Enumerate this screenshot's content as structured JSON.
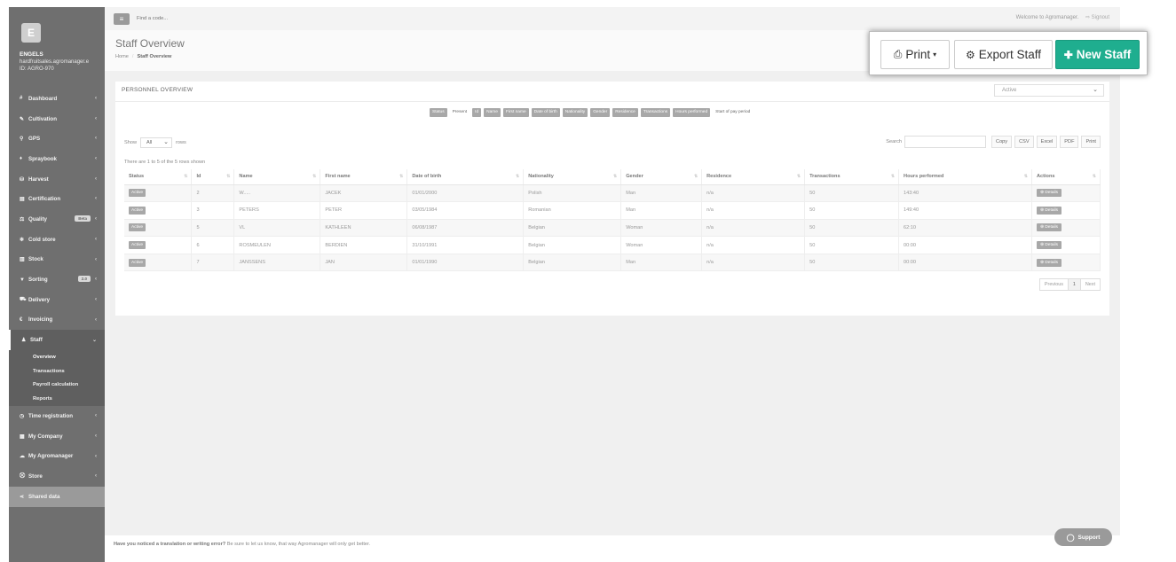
{
  "topbar": {
    "find_placeholder": "Find a code...",
    "welcome": "Welcome to Agromanager.",
    "signout": "Signout"
  },
  "sidebar": {
    "logo_letter": "E",
    "user_name": "ENGELS",
    "user_email": "hardfruitsales.agromanager.e",
    "user_id": "ID: AGRO-970",
    "items": [
      {
        "label": "Dashboard",
        "icon": "#"
      },
      {
        "label": "Cultivation",
        "icon": "✎"
      },
      {
        "label": "GPS",
        "icon": "⚲"
      },
      {
        "label": "Spraybook",
        "icon": "♦"
      },
      {
        "label": "Harvest",
        "icon": "⛁"
      },
      {
        "label": "Certification",
        "icon": "▤"
      },
      {
        "label": "Quality",
        "icon": "⚖",
        "badge": "Beta"
      },
      {
        "label": "Cold store",
        "icon": "❄"
      },
      {
        "label": "Stock",
        "icon": "▥"
      },
      {
        "label": "Sorting",
        "icon": "▼",
        "badge": "2.0"
      },
      {
        "label": "Delivery",
        "icon": "⛟"
      },
      {
        "label": "Invoicing",
        "icon": "€"
      },
      {
        "label": "Staff",
        "icon": "♟"
      }
    ],
    "staff_sub": [
      "Overview",
      "Transactions",
      "Payroll calculation",
      "Reports"
    ],
    "items_after": [
      {
        "label": "Time registration",
        "icon": "◷"
      },
      {
        "label": "My Company",
        "icon": "▦"
      },
      {
        "label": "My Agromanager",
        "icon": "☁"
      },
      {
        "label": "Store",
        "icon": "⛒"
      }
    ],
    "shared": {
      "label": "Shared data",
      "icon": "⋖"
    }
  },
  "header": {
    "title": "Staff Overview",
    "breadcrumb_home": "Home",
    "breadcrumb_current": "Staff Overview"
  },
  "actions": {
    "print": "Print",
    "export": "Export Staff",
    "new": "New Staff"
  },
  "card": {
    "title": "PERSONNEL OVERVIEW",
    "status_filter": "Active",
    "toggles": [
      {
        "label": "Status",
        "on": true
      },
      {
        "label": "Present",
        "on": false
      },
      {
        "label": "Id",
        "on": true
      },
      {
        "label": "Name",
        "on": true
      },
      {
        "label": "First name",
        "on": true
      },
      {
        "label": "Date of birth",
        "on": true
      },
      {
        "label": "Nationality",
        "on": true
      },
      {
        "label": "Gender",
        "on": true
      },
      {
        "label": "Residence",
        "on": true
      },
      {
        "label": "Transactions",
        "on": true
      },
      {
        "label": "Hours performed",
        "on": true
      },
      {
        "label": "Start of pay period",
        "on": false
      }
    ],
    "show_label": "Show",
    "show_value": "All",
    "rows_label": "rows",
    "search_label": "Search",
    "export_buttons": [
      "Copy",
      "CSV",
      "Excel",
      "PDF",
      "Print"
    ],
    "info": "There are 1 to 5 of the 5 rows shown"
  },
  "table": {
    "columns": [
      "Status",
      "Id",
      "Name",
      "First name",
      "Date of birth",
      "Nationality",
      "Gender",
      "Residence",
      "Transactions",
      "Hours performed",
      "Actions"
    ],
    "rows": [
      {
        "status": "Active",
        "id": "2",
        "name": "W.....",
        "first_name": "JACEK",
        "dob": "01/01/2000",
        "nationality": "Polish",
        "gender": "Man",
        "residence": "n/a",
        "transactions": "50",
        "hours": "143:40",
        "action": "Details"
      },
      {
        "status": "Active",
        "id": "3",
        "name": "PETERS",
        "first_name": "PETER",
        "dob": "03/05/1984",
        "nationality": "Romanian",
        "gender": "Man",
        "residence": "n/a",
        "transactions": "50",
        "hours": "149:40",
        "action": "Details"
      },
      {
        "status": "Active",
        "id": "5",
        "name": "VL",
        "first_name": "KATHLEEN",
        "dob": "06/08/1987",
        "nationality": "Belgian",
        "gender": "Woman",
        "residence": "n/a",
        "transactions": "50",
        "hours": "62:10",
        "action": "Details"
      },
      {
        "status": "Active",
        "id": "6",
        "name": "ROSMEULEN",
        "first_name": "BERDIEN",
        "dob": "31/10/1991",
        "nationality": "Belgian",
        "gender": "Woman",
        "residence": "n/a",
        "transactions": "50",
        "hours": "00:00",
        "action": "Details"
      },
      {
        "status": "Active",
        "id": "7",
        "name": "JANSSENS",
        "first_name": "JAN",
        "dob": "01/01/1990",
        "nationality": "Belgian",
        "gender": "Man",
        "residence": "n/a",
        "transactions": "50",
        "hours": "00:00",
        "action": "Details"
      }
    ]
  },
  "pager": {
    "previous": "Previous",
    "page": "1",
    "next": "Next"
  },
  "footer": {
    "bold": "Have you noticed a translation or writing error?",
    "rest": " Be sure to let us know, that way Agromanager will only get better."
  },
  "support": "Support",
  "colors": {
    "accent": "#1fae8f",
    "sidebar": "#6f6f6f"
  }
}
